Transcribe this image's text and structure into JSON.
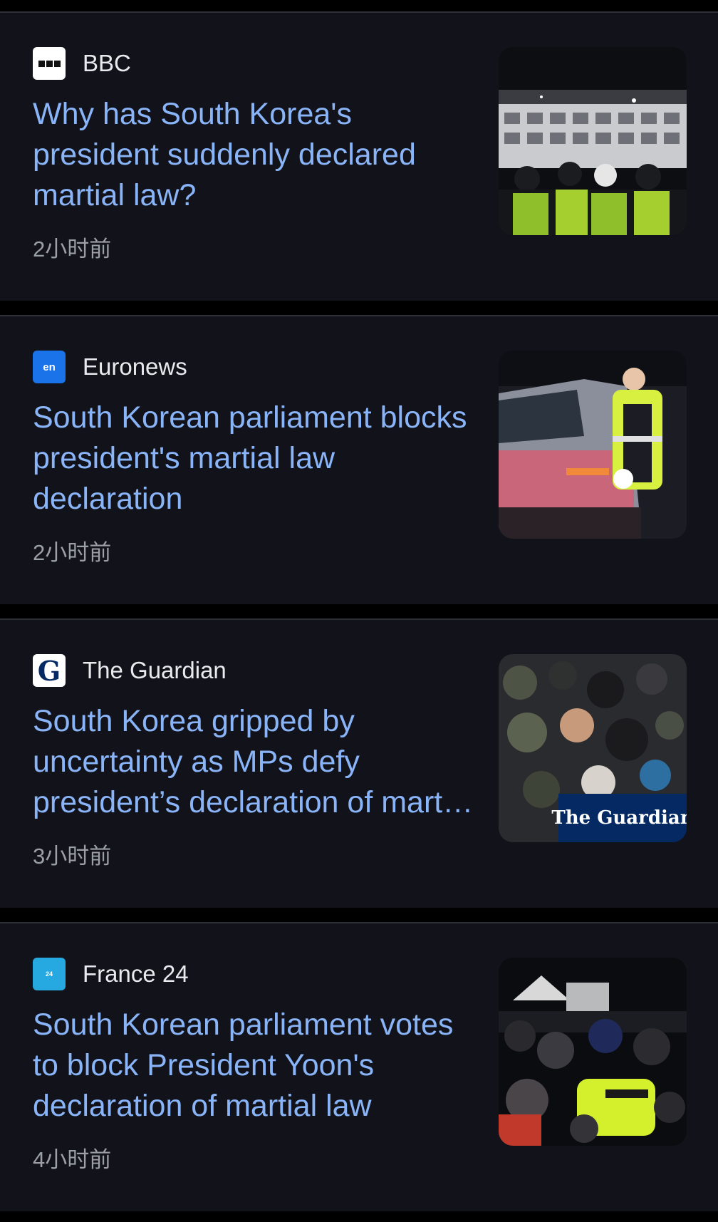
{
  "feed": {
    "articles": [
      {
        "source": "BBC",
        "headline": "Why has South Korea's president suddenly declared martial law?",
        "time": "2小时前",
        "logo_icon": "bbc-logo-icon",
        "thumb_icon": "police-night-photo"
      },
      {
        "source": "Euronews",
        "headline": "South Korean parliament blocks president's martial law declaration",
        "time": "2小时前",
        "logo_icon": "euronews-logo-icon",
        "logo_text": "en",
        "thumb_icon": "police-car-photo"
      },
      {
        "source": "The Guardian",
        "headline": "South Korea gripped by uncertainty as MPs defy president’s declaration of martial law",
        "time": "3小时前",
        "logo_icon": "guardian-logo-icon",
        "logo_text": "G",
        "thumb_icon": "crowd-soldiers-photo",
        "thumb_watermark": "The Guardian"
      },
      {
        "source": "France 24",
        "headline": "South Korean parliament votes to block President Yoon's declaration of martial law",
        "time": "4小时前",
        "logo_icon": "france24-logo-icon",
        "logo_text": "24",
        "thumb_icon": "crowd-night-photo"
      }
    ]
  },
  "colors": {
    "background": "#12131a",
    "headline": "#8ab4f8",
    "source": "#e8eaed",
    "time": "#9aa0a6",
    "divider": "#000000"
  }
}
